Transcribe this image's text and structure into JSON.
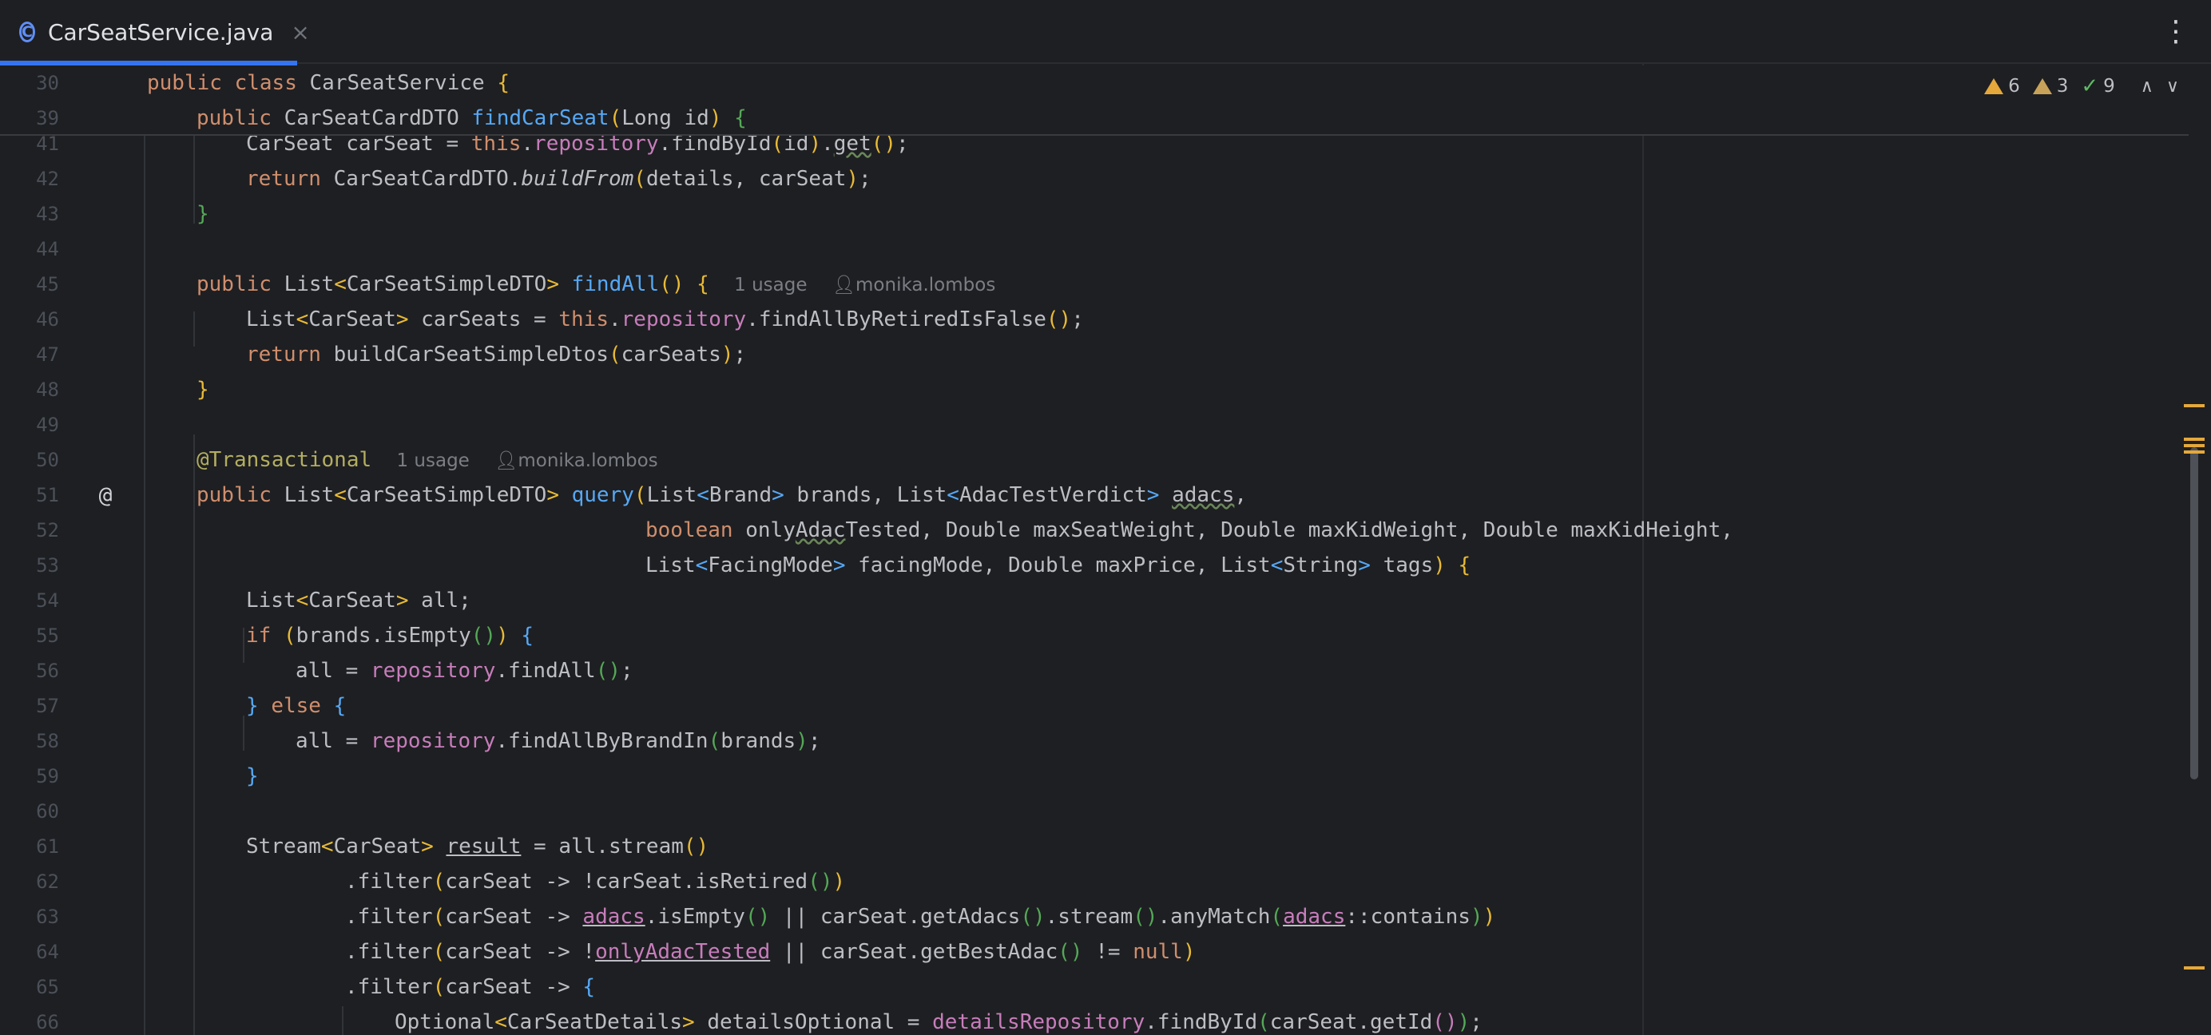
{
  "tab": {
    "icon_letter": "C",
    "title": "CarSeatService.java",
    "close": "×"
  },
  "more_menu": "⋮",
  "inspections": {
    "warnings": "6",
    "weak_warnings": "3",
    "ok": "9",
    "warning_color": "#e5a83b",
    "ok_color": "#5fb865"
  },
  "sticky_lines": [
    {
      "num": "30"
    },
    {
      "num": "39"
    }
  ],
  "lines": [
    {
      "num": "41"
    },
    {
      "num": "42"
    },
    {
      "num": "43"
    },
    {
      "num": "44"
    },
    {
      "num": "45"
    },
    {
      "num": "46"
    },
    {
      "num": "47"
    },
    {
      "num": "48"
    },
    {
      "num": "49"
    },
    {
      "num": "50"
    },
    {
      "num": "51"
    },
    {
      "num": "52"
    },
    {
      "num": "53"
    },
    {
      "num": "54"
    },
    {
      "num": "55"
    },
    {
      "num": "56"
    },
    {
      "num": "57"
    },
    {
      "num": "58"
    },
    {
      "num": "59"
    },
    {
      "num": "60"
    },
    {
      "num": "61"
    },
    {
      "num": "62"
    },
    {
      "num": "63"
    },
    {
      "num": "64"
    },
    {
      "num": "65"
    },
    {
      "num": "66"
    }
  ],
  "code": {
    "public": "public",
    "class": "class",
    "class_name": "CarSeatService",
    "dto_card": "CarSeatCardDTO",
    "find_car_seat": "findCarSeat",
    "long_id": "Long id",
    "l41_a": "CarSeat carSeat = ",
    "this": "this",
    "repository": "repository",
    "l41_b": ".findById",
    "l41_id": "id",
    "l41_get": "get",
    "return": "return",
    "build_from": "buildFrom",
    "l42_args": "details, carSeat",
    "list": "List",
    "simple_dto": "CarSeatSimpleDTO",
    "find_all": "findAll",
    "usage_1": "1 usage",
    "author": "monika.lombos",
    "l46_a": "List",
    "carseat": "CarSeat",
    "l46_b": " carSeats = ",
    "find_all_retired": ".findAllByRetiredIsFalse",
    "build_simple": "buildCarSeatSimpleDtos",
    "carseats": "carSeats",
    "transactional": "@Transactional",
    "query": "query",
    "brand": "Brand",
    "brands": " brands, ",
    "adac_verdict": "AdacTestVerdict",
    "adacs": "adacs",
    "comma": ",",
    "boolean": "boolean",
    "l52_a": " only",
    "adac_word": "Adac",
    "l52_b": "Tested, Double maxSeatWeight, Double maxKidWeight, Double maxKidHeight,",
    "facing_mode": "FacingMode",
    "l53_a": " facingMode, Double maxPrice, ",
    "string": "String",
    "tags": " tags",
    "l54": " all;",
    "if": "if",
    "brands_is_empty": "brands.isEmpty",
    "all_eq": "all = ",
    "dot_find_all": ".findAll",
    "else": "else",
    "find_by_brand": ".findAllByBrandIn",
    "brands_arg": "brands",
    "stream": "Stream",
    "result": "result",
    "l61_b": " = all.stream",
    "filter": ".filter",
    "carseat_arrow": "carSeat -> ",
    "not_retired": "!carSeat.isRetired",
    "is_empty": ".isEmpty",
    "or": " || ",
    "get_adacs": "carSeat.getAdacs",
    "dot_stream": ".stream",
    "any_match": ".anyMatch",
    "contains": "::contains",
    "bang": "!",
    "only_adac_tested": "onlyAdacTested",
    "get_best_adac": "carSeat.getBestAdac",
    "neq": " != ",
    "null": "null",
    "optional": "Optional",
    "car_seat_details": "CarSeatDetails",
    "details_optional": " detailsOptional = ",
    "details_repository": "detailsRepository",
    "find_by_id": ".findById",
    "get_id": "carSeat.getId"
  }
}
